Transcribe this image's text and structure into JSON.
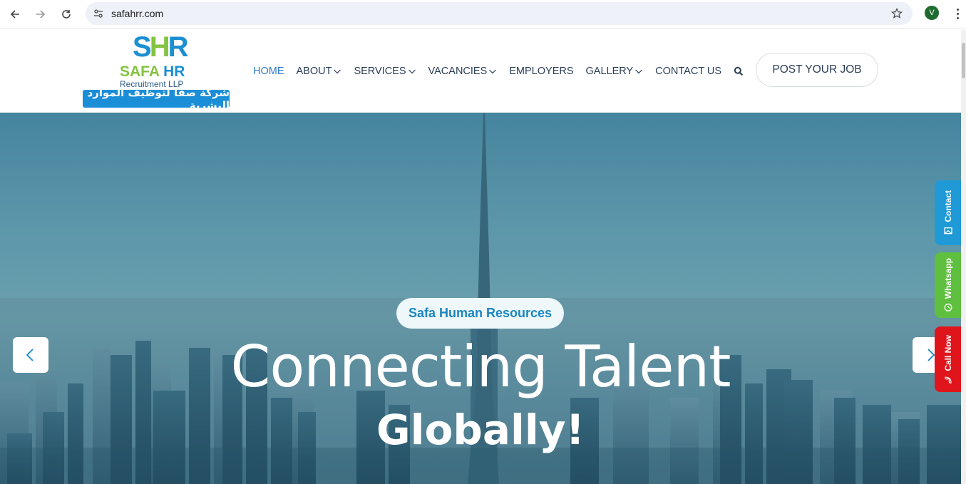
{
  "browser": {
    "url": "safahrr.com",
    "profile_initial": "V"
  },
  "logo": {
    "mark_s": "S",
    "mark_h": "H",
    "mark_r": "R",
    "brand_safa": "SAFA",
    "brand_hr": "HR",
    "subtitle": "Recruitment LLP",
    "arabic": "شركة صفا لتوظيف الموارد البشرية"
  },
  "nav": {
    "items": [
      {
        "label": "HOME",
        "dropdown": false,
        "active": true
      },
      {
        "label": "ABOUT",
        "dropdown": true
      },
      {
        "label": "SERVICES",
        "dropdown": true
      },
      {
        "label": "VACANCIES",
        "dropdown": true
      },
      {
        "label": "EMPLOYERS",
        "dropdown": false
      },
      {
        "label": "GALLERY",
        "dropdown": true
      },
      {
        "label": "CONTACT US",
        "dropdown": false
      }
    ],
    "post_job": "POST YOUR JOB"
  },
  "hero": {
    "pill": "Safa Human Resources",
    "headline": "Connecting Talent",
    "headline2": "Globally!"
  },
  "side_tabs": {
    "contact": "Contact",
    "whatsapp": "Whatsapp",
    "call": "Call Now"
  },
  "colors": {
    "brand_blue": "#1a8fd1",
    "brand_green": "#84c341",
    "nav_active": "#2d7bd0",
    "contact_tab": "#1f9ad6",
    "whatsapp_tab": "#5fbf3f",
    "call_tab": "#e0151b"
  }
}
